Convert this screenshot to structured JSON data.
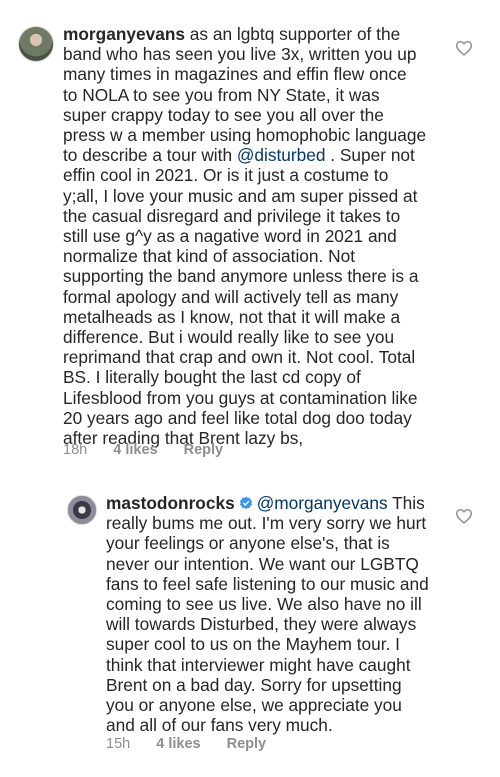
{
  "comments": [
    {
      "username": "morganyevans",
      "text_before_mention": " as an lgbtq supporter of the\nband who has seen you live 3x, written you up\nmany times in magazines and effin flew once\nto NOLA to see you from NY State, it was\nsuper crappy today to see you all over the\npress w a member using homophobic language\nto describe a tour with ",
      "mention": "@disturbed",
      "text_after_mention": " . Super not\neffin cool in 2021. Or is it just a costume to\ny;all, I love your music and am super pissed at\nthe casual disregard and privilege it takes to\nstill use g^y as a nagative word in 2021 and\nnormalize that kind of association. Not\nsupporting the band anymore unless there is a\nformal apology and will actively tell as many\nmetalheads as I know, not that it will make a\ndifference. But i would really like to see you\nreprimand that crap and own it. Not cool. Total\nBS. I literally bought the last cd copy of\nLifesblood from you guys at contamination like\n20 years ago and feel like total dog doo today\nafter reading that Brent lazy bs,",
      "time": "18h",
      "likes": "4 likes",
      "reply": "Reply",
      "avatar_icon": "user-avatar-icon"
    },
    {
      "username": "mastodonrocks",
      "verified": true,
      "mention": "@morganyevans",
      "text_after_mention": " This\nreally bums me out. I'm very sorry we hurt\nyour feelings or anyone else's, that is\nnever our intention. We want our LGBTQ\nfans to feel safe listening to our music and\ncoming to see us live. We also have no ill\nwill towards Disturbed, they were always\nsuper cool to us on the Mayhem tour. I\nthink that interviewer might have caught\nBrent on a bad day. Sorry for upsetting\nyou or anyone else, we appreciate you\nand all of our fans very much.",
      "time": "15h",
      "likes": "4 likes",
      "reply": "Reply",
      "avatar_icon": "band-avatar-icon"
    }
  ],
  "colors": {
    "text": "#262626",
    "mention": "#00376b",
    "meta": "#8e8e8e",
    "verified": "#3897f0"
  },
  "icons": {
    "like": "heart-outline-icon",
    "verified": "verified-badge-icon"
  }
}
